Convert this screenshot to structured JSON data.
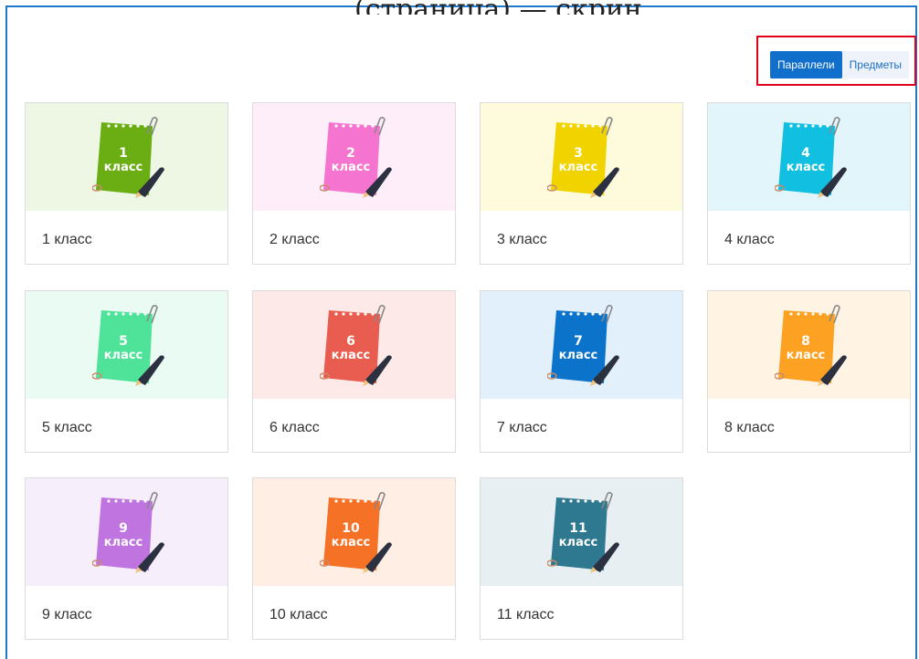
{
  "header": {
    "clipped_title": "(страница) — скрин"
  },
  "view_toggle": {
    "options": [
      {
        "label": "Параллели",
        "active": true
      },
      {
        "label": "Предметы",
        "active": false
      }
    ]
  },
  "grades": [
    {
      "number": "1",
      "word": "класс",
      "label": "1 класс",
      "bg": "#eef7e4",
      "color": "#6aae14"
    },
    {
      "number": "2",
      "word": "класс",
      "label": "2 класс",
      "bg": "#fdeefa",
      "color": "#f574cf"
    },
    {
      "number": "3",
      "word": "класс",
      "label": "3 класс",
      "bg": "#fdfbdc",
      "color": "#f1d300"
    },
    {
      "number": "4",
      "word": "класс",
      "label": "4 класс",
      "bg": "#e1f5fb",
      "color": "#11bfe0"
    },
    {
      "number": "5",
      "word": "класс",
      "label": "5 класс",
      "bg": "#e9fbf2",
      "color": "#4fe39a"
    },
    {
      "number": "6",
      "word": "класс",
      "label": "6 класс",
      "bg": "#fdeae8",
      "color": "#e85d4f"
    },
    {
      "number": "7",
      "word": "класс",
      "label": "7 класс",
      "bg": "#e2f0fb",
      "color": "#0b73c9"
    },
    {
      "number": "8",
      "word": "класс",
      "label": "8 класс",
      "bg": "#fff3e4",
      "color": "#fca121"
    },
    {
      "number": "9",
      "word": "класс",
      "label": "9 класс",
      "bg": "#f7eefc",
      "color": "#bf74e0"
    },
    {
      "number": "10",
      "word": "класс",
      "label": "10 класс",
      "bg": "#ffeee4",
      "color": "#f47126"
    },
    {
      "number": "11",
      "word": "класс",
      "label": "11 класс",
      "bg": "#e7eff2",
      "color": "#2e7890"
    }
  ]
}
